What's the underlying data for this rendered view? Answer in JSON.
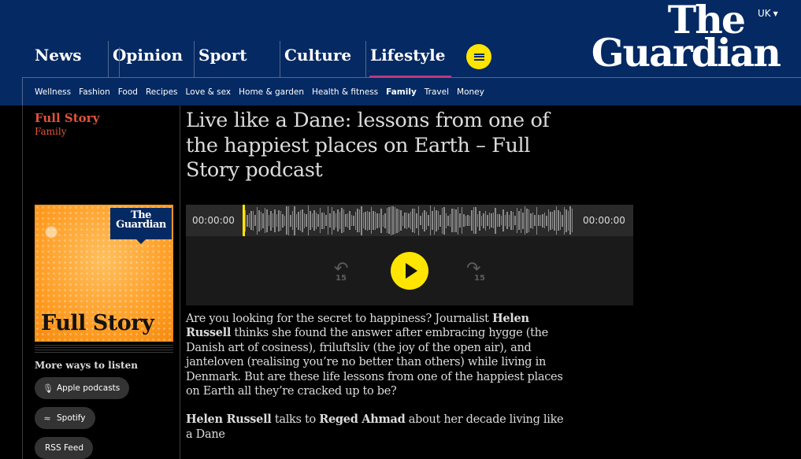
{
  "header": {
    "edition": "UK",
    "logo": {
      "line1": "The",
      "line2": "Guardian"
    },
    "pillars": [
      "News",
      "Opinion",
      "Sport",
      "Culture",
      "Lifestyle"
    ],
    "active_pillar": "Lifestyle",
    "subnav": [
      "Wellness",
      "Fashion",
      "Food",
      "Recipes",
      "Love & sex",
      "Home & garden",
      "Health & fitness",
      "Family",
      "Travel",
      "Money"
    ],
    "current_subnav": "Family",
    "colors": {
      "brand": "#052962",
      "lifestyle_accent": "#bb3b80",
      "menu_button": "#ffe500"
    }
  },
  "series": {
    "title": "Full Story",
    "section": "Family"
  },
  "cover": {
    "badge_line1": "The",
    "badge_line2": "Guardian",
    "title": "Full Story"
  },
  "listen": {
    "heading": "More ways to listen",
    "links": [
      {
        "label": "Apple podcasts",
        "icon": "podcast-icon"
      },
      {
        "label": "Spotify",
        "icon": "spotify-icon"
      },
      {
        "label": "RSS Feed",
        "icon": ""
      }
    ]
  },
  "article": {
    "headline": "Live like a Dane: lessons from one of the happiest places on Earth – Full Story podcast"
  },
  "player": {
    "current_time": "00:00:00",
    "duration": "00:00:00",
    "skip_back": "15",
    "skip_forward": "15",
    "progress": 0
  },
  "standfirst": {
    "p1_a": "Are you looking for the secret to happiness? Journalist ",
    "p1_name": "Helen Russell",
    "p1_b": " thinks she found the answer after embracing hygge (the Danish art of cosiness), friluftsliv (the joy of the open air), and janteloven (realising you’re no better than others) while living in Denmark. But are these life lessons from one of the happiest places on Earth all they’re cracked up to be?",
    "p2_name1": "Helen Russell",
    "p2_a": " talks to ",
    "p2_name2": "Reged Ahmad",
    "p2_b": " about her decade living like a Dane"
  }
}
